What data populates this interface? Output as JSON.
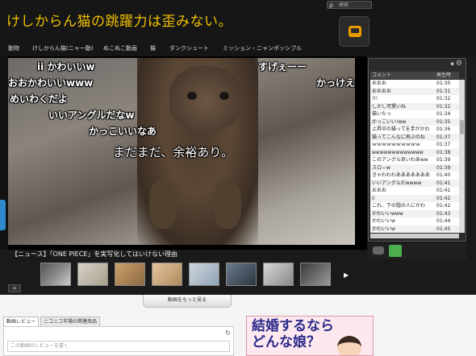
{
  "header": {
    "title": "けしからん猫の跳躍力は歪みない。",
    "search_label": "検索",
    "nav": [
      "動物",
      "けしからん猫(ニャー動)",
      "ぬこぬこ動画",
      "猫",
      "ダンクシュート",
      "ミッション・ニャンポッシブル"
    ]
  },
  "player": {
    "overlay_comments": [
      {
        "text": "ii かわいいw",
        "big": false
      },
      {
        "text": "おおかわいいwww",
        "big": false
      },
      {
        "text": "めいわくだよ",
        "big": false
      },
      {
        "text": "いいアングルだなw",
        "big": false
      },
      {
        "text": "かっこいいなあ",
        "big": false
      },
      {
        "text": "まだまだ、余裕あり。",
        "big": true
      },
      {
        "text": "すげぇーー",
        "big": false
      },
      {
        "text": "かっけえw",
        "big": false
      }
    ]
  },
  "comment_panel": {
    "column_comment": "コメント",
    "column_time": "再生時",
    "rows": [
      {
        "comment": "おおお",
        "time": "01:30"
      },
      {
        "comment": "おおおお",
        "time": "01:31"
      },
      {
        "comment": "!!!",
        "time": "01:32"
      },
      {
        "comment": "しかし可愛いね",
        "time": "01:32"
      },
      {
        "comment": "猫いたっ",
        "time": "01:34"
      },
      {
        "comment": "かっこいい!ww",
        "time": "01:35"
      },
      {
        "comment": "上昇中の猫ってを手がかわ",
        "time": "01:36"
      },
      {
        "comment": "猫ってこんなに飛ぶのね",
        "time": "01:37"
      },
      {
        "comment": "ｗｗｗｗｗｗｗｗｗｗ",
        "time": "01:37"
      },
      {
        "comment": "wwwwwwwwwwwww",
        "time": "01:38"
      },
      {
        "comment": "このアングル良いわあww",
        "time": "01:39"
      },
      {
        "comment": "スロ―w",
        "time": "01:39"
      },
      {
        "comment": "きゃわわわあああああああ",
        "time": "01:40"
      },
      {
        "comment": "いいアングルだwwww",
        "time": "01:41"
      },
      {
        "comment": "おおお",
        "time": "01:41"
      },
      {
        "comment": "ii",
        "time": "01:42"
      },
      {
        "comment": "これ、下の階の人にかわ",
        "time": "01:42"
      },
      {
        "comment": "かわいいwww",
        "time": "01:43"
      },
      {
        "comment": "かわいいw",
        "time": "01:44"
      },
      {
        "comment": "かわいいw",
        "time": "01:45"
      }
    ]
  },
  "news": "【ニュース】「ONE PIECE」を実写化してはいけない理由",
  "more_videos": "動画をもっと見る",
  "tabs": [
    "動画レビュー",
    "ニコニコ市場の関連商品"
  ],
  "review_placeholder": "この動画のレビューを書く",
  "ad": {
    "line1": "結婚するなら",
    "line2": "どんな娘？"
  },
  "colors": {
    "title": "#f0c000",
    "background": "#1a1a1a"
  }
}
